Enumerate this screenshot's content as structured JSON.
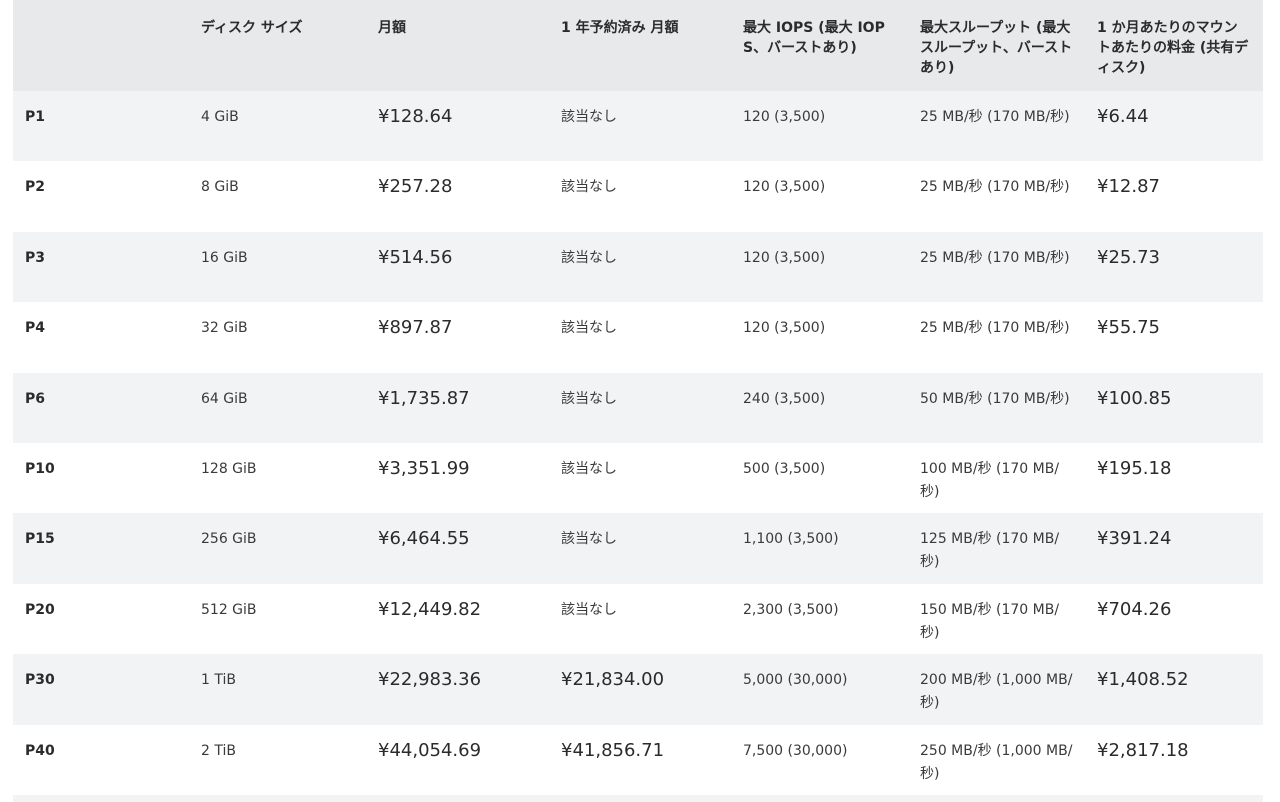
{
  "header": {
    "col0": "",
    "col1": "ディスク サイズ",
    "col2": "月額",
    "col3": "1 年予約済み 月額",
    "col4": "最大 IOPS (最大 IOPS、バーストあり)",
    "col5": "最大スループット (最大スループット、バーストあり)",
    "col6": "1 か月あたりのマウントあたりの料金 (共有ディスク)"
  },
  "rows": [
    {
      "tier": "P1",
      "size": "4 GiB",
      "monthly": "¥128.64",
      "reserved": "該当なし",
      "iops": "120 (3,500)",
      "throughput": "25 MB/秒 (170 MB/秒)",
      "shared": "¥6.44"
    },
    {
      "tier": "P2",
      "size": "8 GiB",
      "monthly": "¥257.28",
      "reserved": "該当なし",
      "iops": "120 (3,500)",
      "throughput": "25 MB/秒 (170 MB/秒)",
      "shared": "¥12.87"
    },
    {
      "tier": "P3",
      "size": "16 GiB",
      "monthly": "¥514.56",
      "reserved": "該当なし",
      "iops": "120 (3,500)",
      "throughput": "25 MB/秒 (170 MB/秒)",
      "shared": "¥25.73"
    },
    {
      "tier": "P4",
      "size": "32 GiB",
      "monthly": "¥897.87",
      "reserved": "該当なし",
      "iops": "120 (3,500)",
      "throughput": "25 MB/秒 (170 MB/秒)",
      "shared": "¥55.75"
    },
    {
      "tier": "P6",
      "size": "64 GiB",
      "monthly": "¥1,735.87",
      "reserved": "該当なし",
      "iops": "240 (3,500)",
      "throughput": "50 MB/秒 (170 MB/秒)",
      "shared": "¥100.85"
    },
    {
      "tier": "P10",
      "size": "128 GiB",
      "monthly": "¥3,351.99",
      "reserved": "該当なし",
      "iops": "500 (3,500)",
      "throughput": "100 MB/秒 (170 MB/秒)",
      "shared": "¥195.18"
    },
    {
      "tier": "P15",
      "size": "256 GiB",
      "monthly": "¥6,464.55",
      "reserved": "該当なし",
      "iops": "1,100 (3,500)",
      "throughput": "125 MB/秒 (170 MB/秒)",
      "shared": "¥391.24"
    },
    {
      "tier": "P20",
      "size": "512 GiB",
      "monthly": "¥12,449.82",
      "reserved": "該当なし",
      "iops": "2,300 (3,500)",
      "throughput": "150 MB/秒 (170 MB/秒)",
      "shared": "¥704.26"
    },
    {
      "tier": "P30",
      "size": "1 TiB",
      "monthly": "¥22,983.36",
      "reserved": "¥21,834.00",
      "iops": "5,000 (30,000)",
      "throughput": "200 MB/秒 (1,000 MB/秒)",
      "shared": "¥1,408.52"
    },
    {
      "tier": "P40",
      "size": "2 TiB",
      "monthly": "¥44,054.69",
      "reserved": "¥41,856.71",
      "iops": "7,500 (30,000)",
      "throughput": "250 MB/秒 (1,000 MB/秒)",
      "shared": "¥2,817.18"
    }
  ]
}
